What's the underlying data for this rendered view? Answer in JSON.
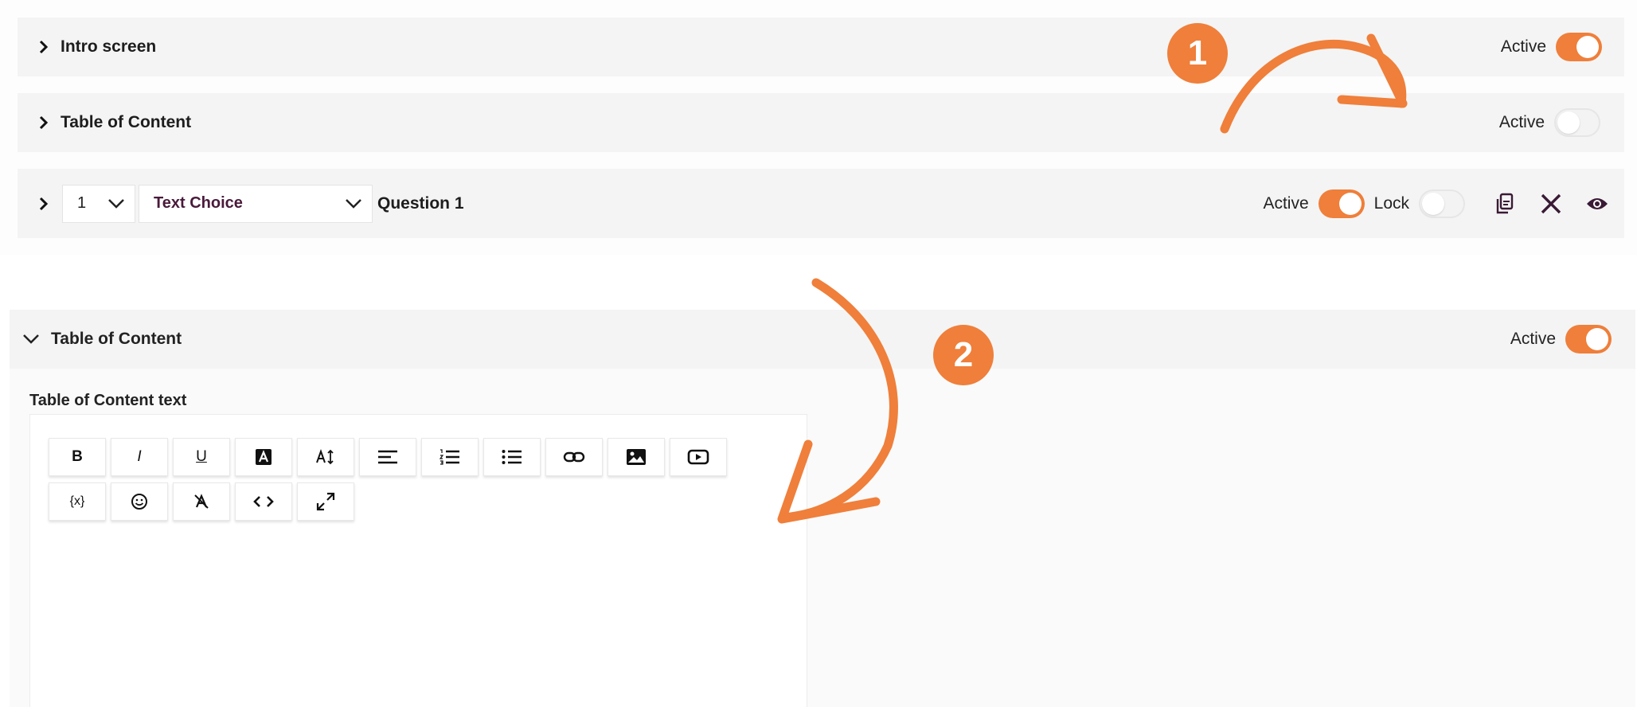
{
  "rows": {
    "intro": {
      "title": "Intro screen",
      "active_label": "Active",
      "active": true
    },
    "toc": {
      "title": "Table of Content",
      "active_label": "Active",
      "active": false
    },
    "question": {
      "number": "1",
      "type": "Text Choice",
      "title": "Question 1",
      "active_label": "Active",
      "active": true,
      "lock_label": "Lock",
      "locked": false
    }
  },
  "expanded": {
    "title": "Table of Content",
    "active_label": "Active",
    "active": true,
    "field_label": "Table of Content text",
    "toolbar_row1": [
      "bold-icon",
      "italic-icon",
      "underline-icon",
      "text-color-icon",
      "font-size-icon",
      "align-left-icon",
      "ordered-list-icon",
      "bullet-list-icon",
      "link-icon",
      "image-icon",
      "video-icon"
    ],
    "toolbar_row2": [
      "variable-icon",
      "emoji-icon",
      "clear-format-icon",
      "code-view-icon",
      "fullscreen-icon"
    ],
    "toolbar_text": {
      "bold": "B",
      "italic": "I",
      "underline": "U",
      "variable": "{x}"
    }
  },
  "annotations": {
    "badge1": "1",
    "badge2": "2"
  },
  "colors": {
    "accent": "#ef7f3a",
    "select_text": "#4a1a3a",
    "icon_dark": "#3a1a34"
  }
}
